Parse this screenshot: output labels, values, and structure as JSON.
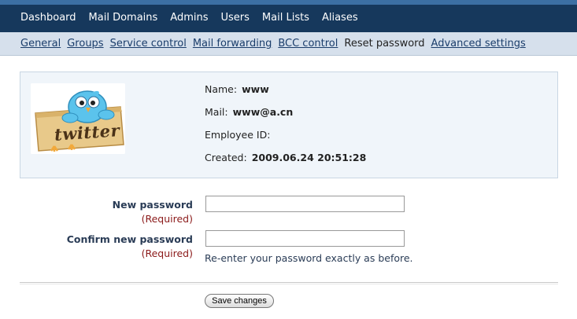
{
  "topnav": {
    "items": [
      "Dashboard",
      "Mail Domains",
      "Admins",
      "Users",
      "Mail Lists",
      "Aliases"
    ]
  },
  "subnav": {
    "items": [
      "General",
      "Groups",
      "Service control",
      "Mail forwarding",
      "BCC control",
      "Reset password",
      "Advanced settings"
    ],
    "active": "Reset password"
  },
  "profile": {
    "avatar_text": "twitter",
    "name_label": "Name:",
    "name_value": "www",
    "mail_label": "Mail:",
    "mail_value": "www@a.cn",
    "employee_label": "Employee ID:",
    "employee_value": "",
    "created_label": "Created:",
    "created_value": "2009.06.24 20:51:28"
  },
  "form": {
    "new_password_label": "New password",
    "new_password_required": "(Required)",
    "new_password_value": "",
    "confirm_password_label": "Confirm new password",
    "confirm_password_required": "(Required)",
    "confirm_password_value": "",
    "confirm_hint": "Re-enter your password exactly as before.",
    "save_label": "Save changes"
  },
  "colors": {
    "topnav_bg": "#16385c",
    "subnav_bg": "#d6e0ec",
    "required": "#8b1a1a",
    "profile_bg": "#f0f5fa"
  }
}
